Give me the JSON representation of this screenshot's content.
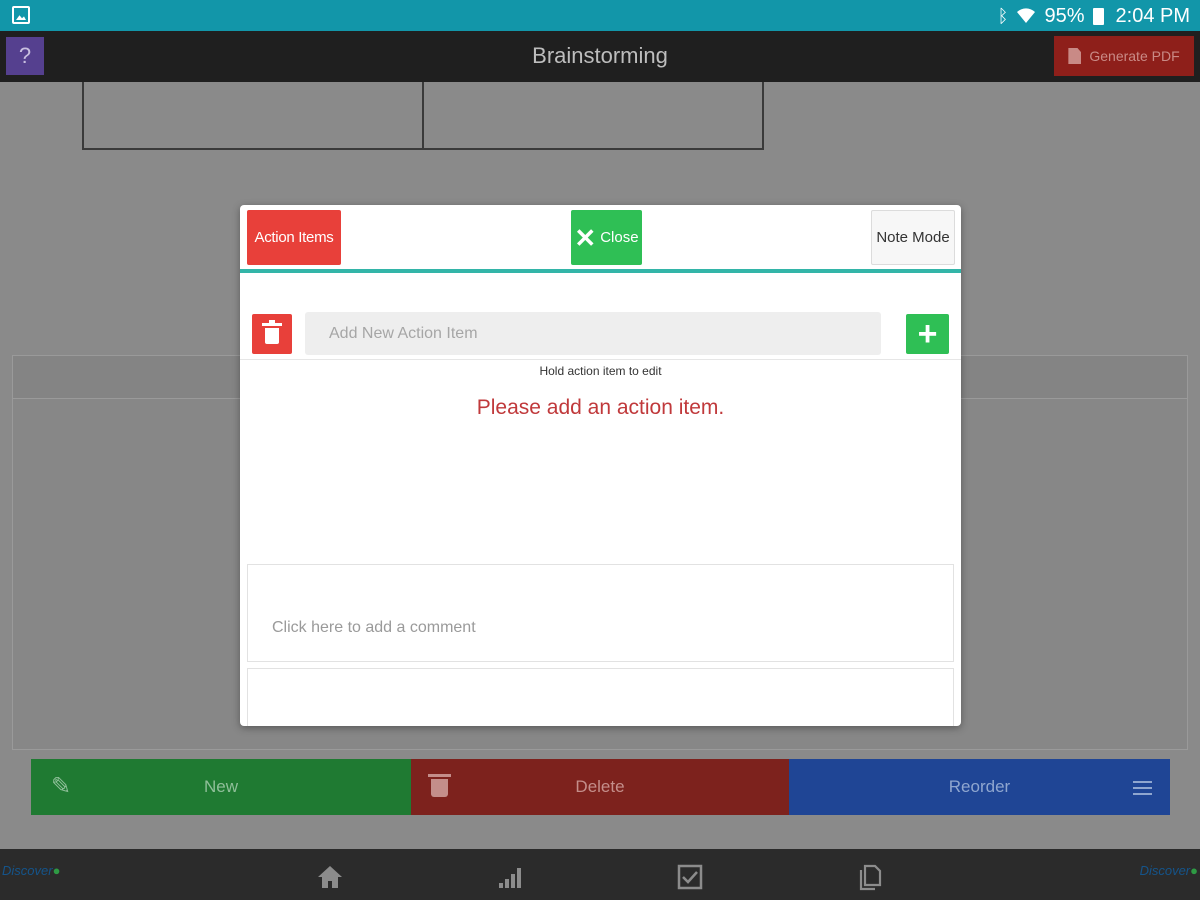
{
  "status_bar": {
    "battery": "95%",
    "time": "2:04 PM",
    "icons": [
      "gallery-icon",
      "bluetooth-icon",
      "wifi-icon",
      "battery-icon"
    ]
  },
  "app_bar": {
    "help_label": "?",
    "title": "Brainstorming",
    "generate_pdf_label": "Generate PDF"
  },
  "modal": {
    "action_items_label": "Action Items",
    "close_label": "Close",
    "note_mode_label": "Note Mode",
    "add_placeholder": "Add New Action Item",
    "hint": "Hold action item to edit",
    "empty_message": "Please add an action item.",
    "comment_placeholder": "Click here to add a comment"
  },
  "bottom_actions": {
    "new_label": "New",
    "delete_label": "Delete",
    "reorder_label": "Reorder"
  },
  "bottom_nav": {
    "items": [
      "home-icon",
      "stats-icon",
      "checklist-icon",
      "documents-icon"
    ]
  },
  "colors": {
    "status_bar": "#1296a9",
    "accent_teal": "#33b5a8",
    "red": "#e8403a",
    "green": "#2fbf55",
    "message_red": "#c0393b"
  }
}
